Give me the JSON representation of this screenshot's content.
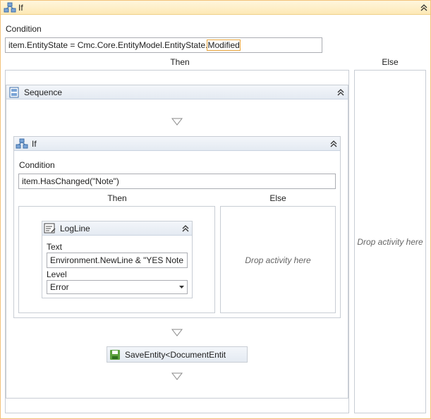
{
  "outer_if": {
    "title": "If",
    "condition_label": "Condition",
    "condition_prefix": "item.EntityState = Cmc.Core.EntityModel.EntityState.",
    "condition_highlight": "Modified",
    "then_label": "Then",
    "else_label": "Else",
    "else_drop_hint": "Drop activity here"
  },
  "sequence": {
    "title": "Sequence"
  },
  "inner_if": {
    "title": "If",
    "condition_label": "Condition",
    "condition_value": "item.HasChanged(\"Note\")",
    "then_label": "Then",
    "else_label": "Else",
    "else_drop_hint": "Drop activity here"
  },
  "logline": {
    "title": "LogLine",
    "text_label": "Text",
    "text_value": "Environment.NewLine & \"YES Note",
    "level_label": "Level",
    "level_value": "Error"
  },
  "save_entity": {
    "title": "SaveEntity<DocumentEntit"
  },
  "colors": {
    "outer_border": "#f2c27a",
    "header_blue": "#e4eaf2",
    "highlight": "#e8a33b",
    "save_icon": "#5aa03c"
  }
}
